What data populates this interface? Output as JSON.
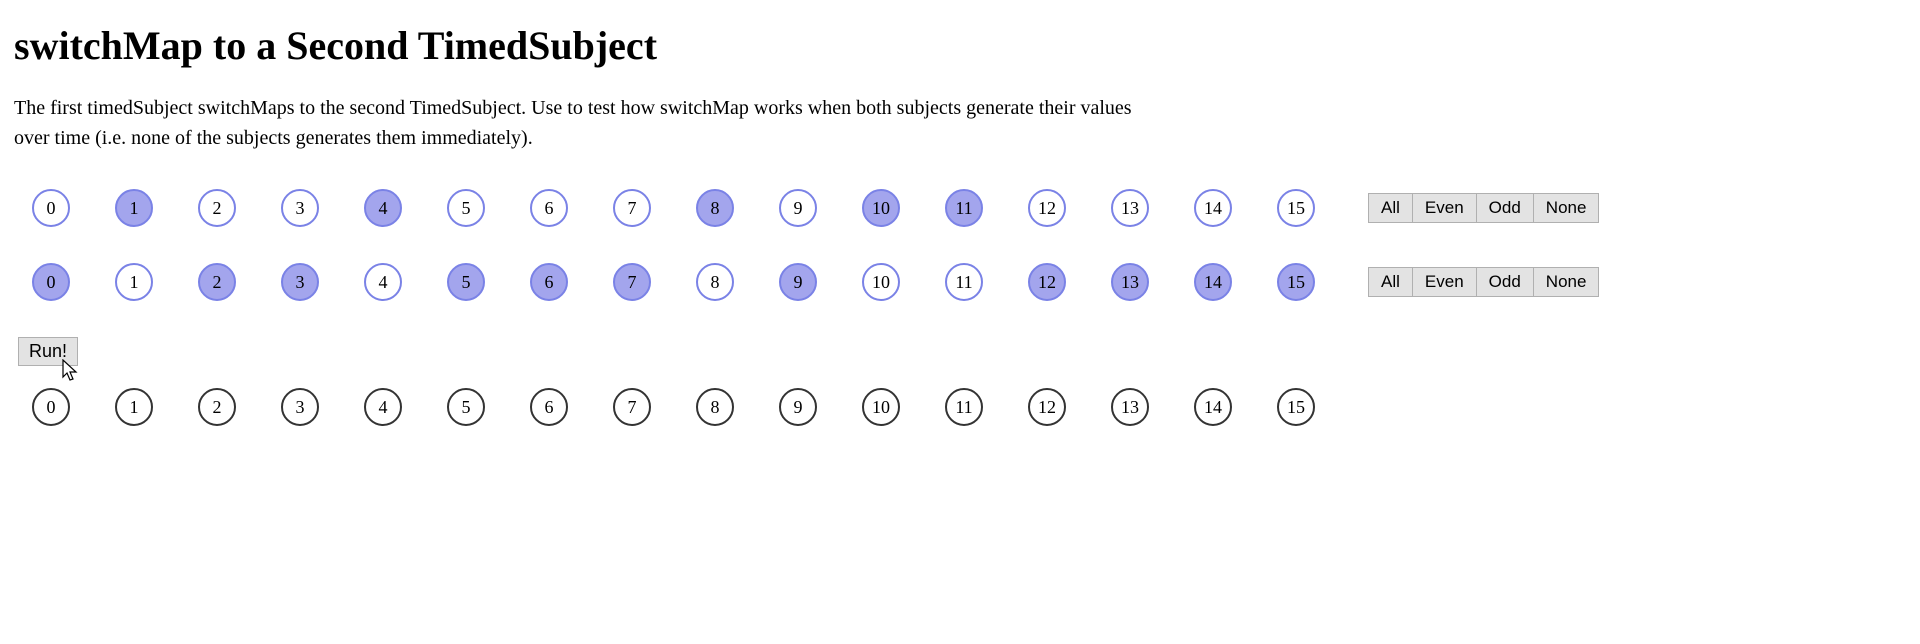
{
  "title": "switchMap to a Second TimedSubject",
  "description": "The first timedSubject switchMaps to the second TimedSubject. Use to test how switchMap works when both subjects generate their values over time (i.e. none of the subjects generates them immediately).",
  "rows": [
    {
      "items": [
        {
          "n": "0",
          "selected": false
        },
        {
          "n": "1",
          "selected": true
        },
        {
          "n": "2",
          "selected": false
        },
        {
          "n": "3",
          "selected": false
        },
        {
          "n": "4",
          "selected": true
        },
        {
          "n": "5",
          "selected": false
        },
        {
          "n": "6",
          "selected": false
        },
        {
          "n": "7",
          "selected": false
        },
        {
          "n": "8",
          "selected": true
        },
        {
          "n": "9",
          "selected": false
        },
        {
          "n": "10",
          "selected": true
        },
        {
          "n": "11",
          "selected": true
        },
        {
          "n": "12",
          "selected": false
        },
        {
          "n": "13",
          "selected": false
        },
        {
          "n": "14",
          "selected": false
        },
        {
          "n": "15",
          "selected": false
        }
      ],
      "buttons": [
        "All",
        "Even",
        "Odd",
        "None"
      ]
    },
    {
      "items": [
        {
          "n": "0",
          "selected": true
        },
        {
          "n": "1",
          "selected": false
        },
        {
          "n": "2",
          "selected": true
        },
        {
          "n": "3",
          "selected": true
        },
        {
          "n": "4",
          "selected": false
        },
        {
          "n": "5",
          "selected": true
        },
        {
          "n": "6",
          "selected": true
        },
        {
          "n": "7",
          "selected": true
        },
        {
          "n": "8",
          "selected": false
        },
        {
          "n": "9",
          "selected": true
        },
        {
          "n": "10",
          "selected": false
        },
        {
          "n": "11",
          "selected": false
        },
        {
          "n": "12",
          "selected": true
        },
        {
          "n": "13",
          "selected": true
        },
        {
          "n": "14",
          "selected": true
        },
        {
          "n": "15",
          "selected": true
        }
      ],
      "buttons": [
        "All",
        "Even",
        "Odd",
        "None"
      ]
    }
  ],
  "run_label": "Run!",
  "output_row": {
    "items": [
      {
        "n": "0"
      },
      {
        "n": "1"
      },
      {
        "n": "2"
      },
      {
        "n": "3"
      },
      {
        "n": "4"
      },
      {
        "n": "5"
      },
      {
        "n": "6"
      },
      {
        "n": "7"
      },
      {
        "n": "8"
      },
      {
        "n": "9"
      },
      {
        "n": "10"
      },
      {
        "n": "11"
      },
      {
        "n": "12"
      },
      {
        "n": "13"
      },
      {
        "n": "14"
      },
      {
        "n": "15"
      }
    ]
  }
}
